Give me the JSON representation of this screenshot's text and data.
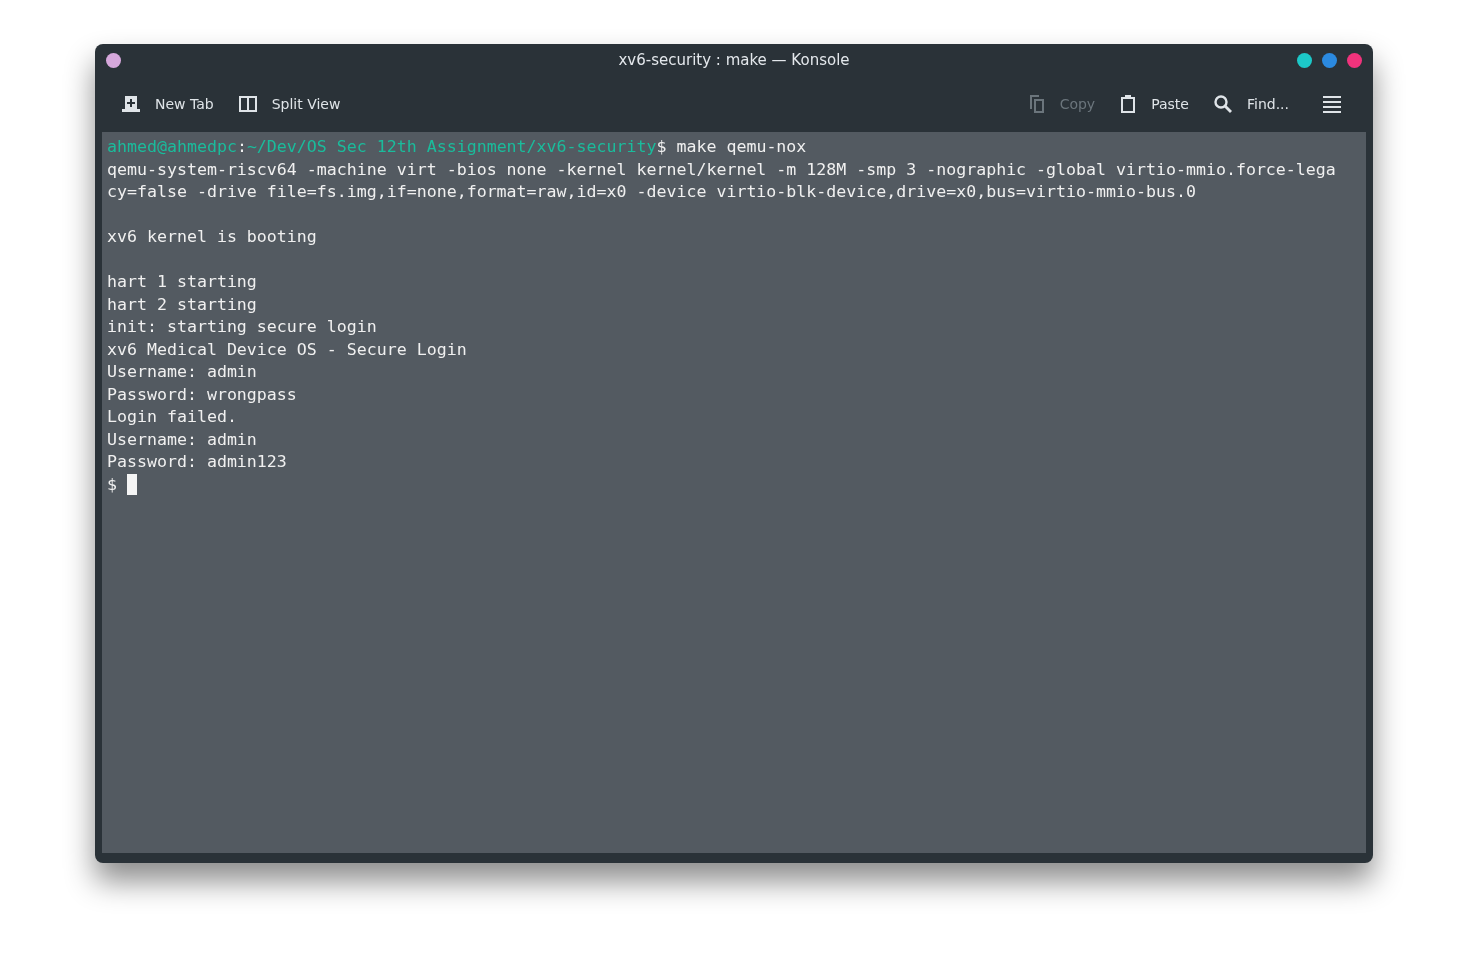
{
  "window": {
    "title": "xv6-security : make — Konsole",
    "left_buttons": [
      {
        "color": "#d6a8dc"
      }
    ],
    "right_buttons": [
      {
        "color": "#1cc8c8"
      },
      {
        "color": "#2b8ae0"
      },
      {
        "color": "#f0337c"
      }
    ]
  },
  "toolbar": {
    "left": [
      {
        "kind": "new-tab",
        "label": "New Tab",
        "disabled": false
      },
      {
        "kind": "split-view",
        "label": "Split View",
        "disabled": false
      }
    ],
    "right": [
      {
        "kind": "copy",
        "label": "Copy",
        "disabled": true
      },
      {
        "kind": "paste",
        "label": "Paste",
        "disabled": false
      },
      {
        "kind": "find",
        "label": "Find...",
        "disabled": false
      },
      {
        "kind": "menu",
        "disabled": false
      }
    ]
  },
  "terminal": {
    "lines": [
      {
        "kind": "segments",
        "segments": [
          {
            "text": "ahmed@ahmedpc",
            "color": "#1abc9c"
          },
          {
            "text": ":"
          },
          {
            "text": "~/Dev/OS Sec 12th Assignment/xv6-security",
            "color": "#1abc9c"
          },
          {
            "text": "$ make qemu-nox"
          }
        ]
      },
      {
        "kind": "text",
        "text": "qemu-system-riscv64 -machine virt -bios none -kernel kernel/kernel -m 128M -smp 3 -nographic -global virtio-mmio.force-lega"
      },
      {
        "kind": "text",
        "text": "cy=false -drive file=fs.img,if=none,format=raw,id=x0 -device virtio-blk-device,drive=x0,bus=virtio-mmio-bus.0"
      },
      {
        "kind": "blank"
      },
      {
        "kind": "text",
        "text": "xv6 kernel is booting"
      },
      {
        "kind": "blank"
      },
      {
        "kind": "text",
        "text": "hart 1 starting"
      },
      {
        "kind": "text",
        "text": "hart 2 starting"
      },
      {
        "kind": "text",
        "text": "init: starting secure login"
      },
      {
        "kind": "text",
        "text": "xv6 Medical Device OS - Secure Login"
      },
      {
        "kind": "text",
        "text": "Username: admin"
      },
      {
        "kind": "text",
        "text": "Password: wrongpass"
      },
      {
        "kind": "text",
        "text": "Login failed."
      },
      {
        "kind": "text",
        "text": "Username: admin"
      },
      {
        "kind": "text",
        "text": "Password: admin123"
      },
      {
        "kind": "input",
        "text": "$",
        "cursor": true
      }
    ]
  }
}
